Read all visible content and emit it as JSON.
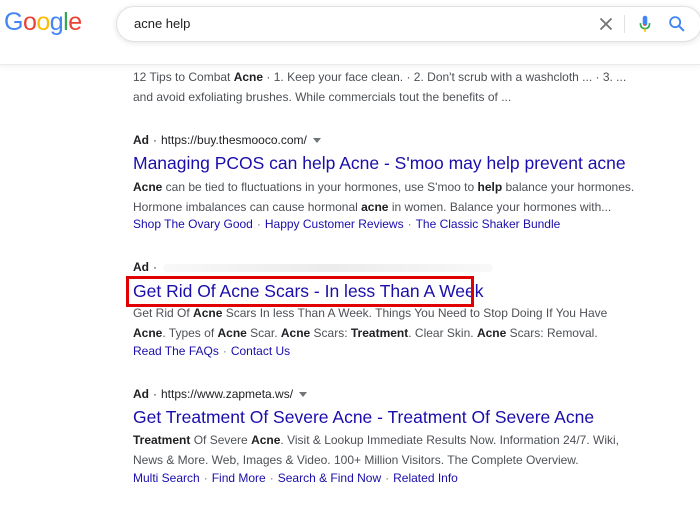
{
  "logo": [
    "G",
    "o",
    "o",
    "g",
    "l",
    "e"
  ],
  "logo_colors": [
    "#4285F4",
    "#EA4335",
    "#FBBC05",
    "#4285F4",
    "#34A853",
    "#EA4335"
  ],
  "search": {
    "value": "acne help"
  },
  "top_snippet": {
    "line1_a": "12 Tips to Combat ",
    "line1_b": "Acne",
    "line1_c": " · 1. Keep your face clean. · 2. Don't scrub with a washcloth ... · 3. ...",
    "line2": "and avoid exfoliating brushes. While commercials tout the benefits of ..."
  },
  "ads": [
    {
      "ad_label": "Ad",
      "url": "https://buy.thesmooco.com/",
      "title": "Managing PCOS can help Acne - S'moo may help prevent acne",
      "desc": {
        "l1_a": "Acne",
        "l1_b": " can be tied to fluctuations in your hormones, use S'moo to ",
        "l1_c": "help",
        "l1_d": " balance your hormones.",
        "l2_a": "Hormone imbalances can cause hormonal ",
        "l2_b": "acne",
        "l2_c": " in women. Balance your hormones with..."
      },
      "sitelinks": [
        "Shop The Ovary Good",
        "Happy Customer Reviews",
        "The Classic Shaker Bundle"
      ]
    },
    {
      "ad_label": "Ad",
      "title": "Get Rid Of Acne Scars - In less Than A Week",
      "desc": {
        "l1_a": "Get Rid Of ",
        "l1_b": "Acne",
        "l1_c": " Scars In less Than A Week. Things You Need to Stop Doing If You Have",
        "l2_a": "Acne",
        "l2_b": ". Types of ",
        "l2_c": "Acne",
        "l2_d": " Scar. ",
        "l2_e": "Acne",
        "l2_f": " Scars: ",
        "l2_g": "Treatment",
        "l2_h": ". Clear Skin. ",
        "l2_i": "Acne",
        "l2_j": " Scars: Removal."
      },
      "sitelinks": [
        "Read The FAQs",
        "Contact Us"
      ]
    },
    {
      "ad_label": "Ad",
      "url": "https://www.zapmeta.ws/",
      "title": "Get Treatment Of Severe Acne - Treatment Of Severe Acne",
      "desc": {
        "l1_a": "Treatment",
        "l1_b": " Of Severe ",
        "l1_c": "Acne",
        "l1_d": ". Visit & Lookup Immediate Results Now. Information 24/7. Wiki,",
        "l2": "News & More. Web, Images & Video. 100+ Million Visitors. The Complete Overview."
      },
      "sitelinks": [
        "Multi Search",
        "Find More",
        "Search & Find Now",
        "Related Info"
      ]
    }
  ],
  "colors": {
    "link": "#1a0dab",
    "highlight": "#e00000",
    "snippet": "#4d5156"
  },
  "icons": {
    "clear": "close-icon",
    "mic": "microphone-icon",
    "search": "search-icon"
  }
}
